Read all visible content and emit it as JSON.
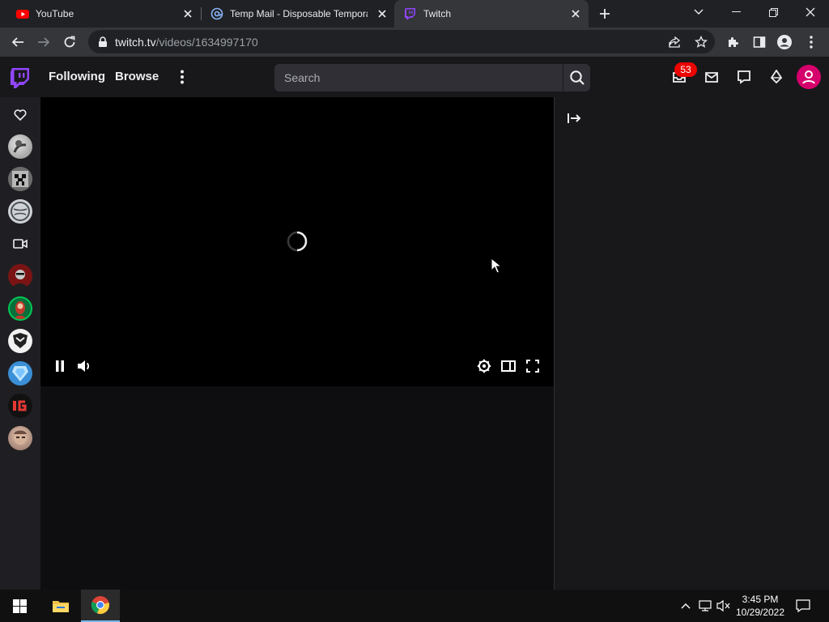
{
  "browser": {
    "tabs": [
      {
        "title": "YouTube",
        "favicon": "youtube-icon",
        "active": false
      },
      {
        "title": "Temp Mail - Disposable Temporary Email",
        "favicon": "at-sign-icon",
        "active": false
      },
      {
        "title": "Twitch",
        "favicon": "twitch-icon",
        "active": true
      }
    ],
    "url": {
      "host": "twitch.tv",
      "path": "/videos/1634997170"
    },
    "accent_colors": {
      "tabstrip": "#202124",
      "toolbar": "#35363a"
    }
  },
  "twitch": {
    "brand_color": "#9146ff",
    "nav": {
      "following": "Following",
      "browse": "Browse"
    },
    "search": {
      "placeholder": "Search"
    },
    "notifications": {
      "count": "53"
    },
    "sidebar": {
      "items": [
        {
          "type": "icon",
          "icon": "heart-icon"
        },
        {
          "type": "avatar"
        },
        {
          "type": "avatar"
        },
        {
          "type": "avatar"
        },
        {
          "type": "icon",
          "icon": "video-camera-icon"
        },
        {
          "type": "avatar"
        },
        {
          "type": "avatar"
        },
        {
          "type": "avatar"
        },
        {
          "type": "avatar"
        },
        {
          "type": "avatar"
        },
        {
          "type": "avatar"
        }
      ]
    },
    "player": {
      "state": "loading",
      "controls_left": [
        "pause-icon",
        "volume-icon"
      ],
      "controls_right": [
        "settings-icon",
        "theatre-mode-icon",
        "fullscreen-icon"
      ]
    }
  },
  "taskbar": {
    "clock": {
      "time": "3:45 PM",
      "date": "10/29/2022"
    },
    "apps": [
      "windows-start-icon",
      "file-explorer-icon",
      "chrome-icon"
    ]
  }
}
